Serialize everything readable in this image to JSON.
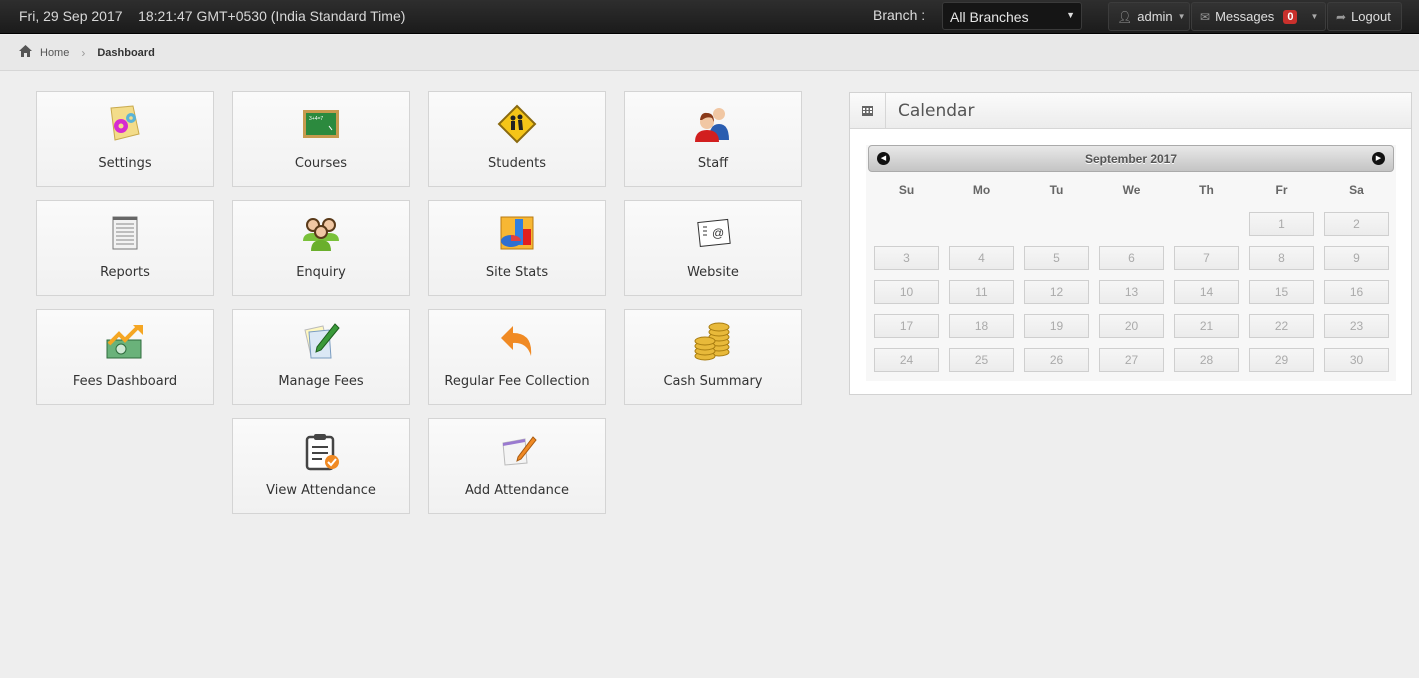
{
  "topbar": {
    "datetime": "Fri, 29 Sep 2017    18:21:47 GMT+0530 (India Standard Time)",
    "branch_label": "Branch :",
    "branch_selected": "All Branches",
    "user_label": "admin",
    "messages_label": "Messages",
    "messages_count": "0",
    "logout_label": "Logout"
  },
  "breadcrumb": {
    "home": "Home",
    "current": "Dashboard"
  },
  "tiles": [
    {
      "label": "Settings",
      "icon": "settings-gears-icon"
    },
    {
      "label": "Courses",
      "icon": "chalkboard-icon"
    },
    {
      "label": "Students",
      "icon": "school-crossing-sign-icon"
    },
    {
      "label": "Staff",
      "icon": "staff-people-icon"
    },
    {
      "label": "Reports",
      "icon": "notepad-icon"
    },
    {
      "label": "Enquiry",
      "icon": "group-people-icon"
    },
    {
      "label": "Site Stats",
      "icon": "charts-icon"
    },
    {
      "label": "Website",
      "icon": "web-mail-icon"
    },
    {
      "label": "Fees Dashboard",
      "icon": "money-growth-icon"
    },
    {
      "label": "Manage Fees",
      "icon": "paper-pencil-icon"
    },
    {
      "label": "Regular Fee Collection",
      "icon": "undo-arrow-icon"
    },
    {
      "label": "Cash Summary",
      "icon": "coins-icon"
    },
    {
      "label": "View Attendance",
      "icon": "clipboard-check-icon"
    },
    {
      "label": "Add Attendance",
      "icon": "notepad-pencil-icon"
    }
  ],
  "calendar": {
    "title": "Calendar",
    "month_label": "September 2017",
    "weekdays": [
      "Su",
      "Mo",
      "Tu",
      "We",
      "Th",
      "Fr",
      "Sa"
    ],
    "first_weekday_index": 5,
    "days": [
      "1",
      "2",
      "3",
      "4",
      "5",
      "6",
      "7",
      "8",
      "9",
      "10",
      "11",
      "12",
      "13",
      "14",
      "15",
      "16",
      "17",
      "18",
      "19",
      "20",
      "21",
      "22",
      "23",
      "24",
      "25",
      "26",
      "27",
      "28",
      "29",
      "30"
    ]
  }
}
